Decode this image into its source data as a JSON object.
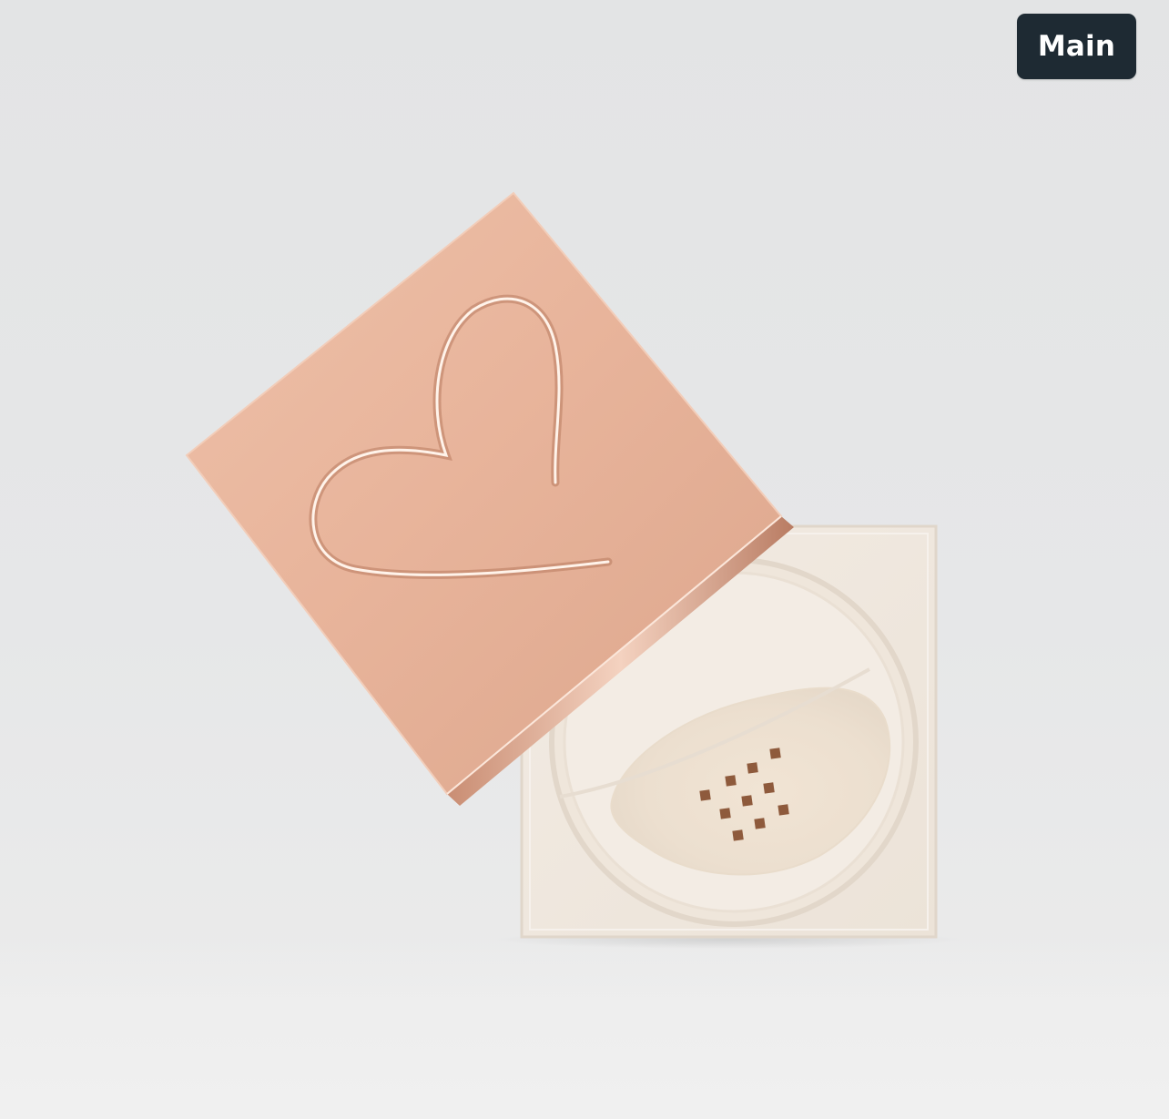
{
  "badge": {
    "label": "Main"
  },
  "colors": {
    "background": "#e6e7e8",
    "badge_bg": "#1e2a33",
    "badge_text": "#ffffff",
    "lid_rose_gold": "#e6b198",
    "powder": "#efe2d2"
  },
  "image": {
    "subject_icon": "loose-powder-jar-with-rose-gold-heart-lid"
  }
}
